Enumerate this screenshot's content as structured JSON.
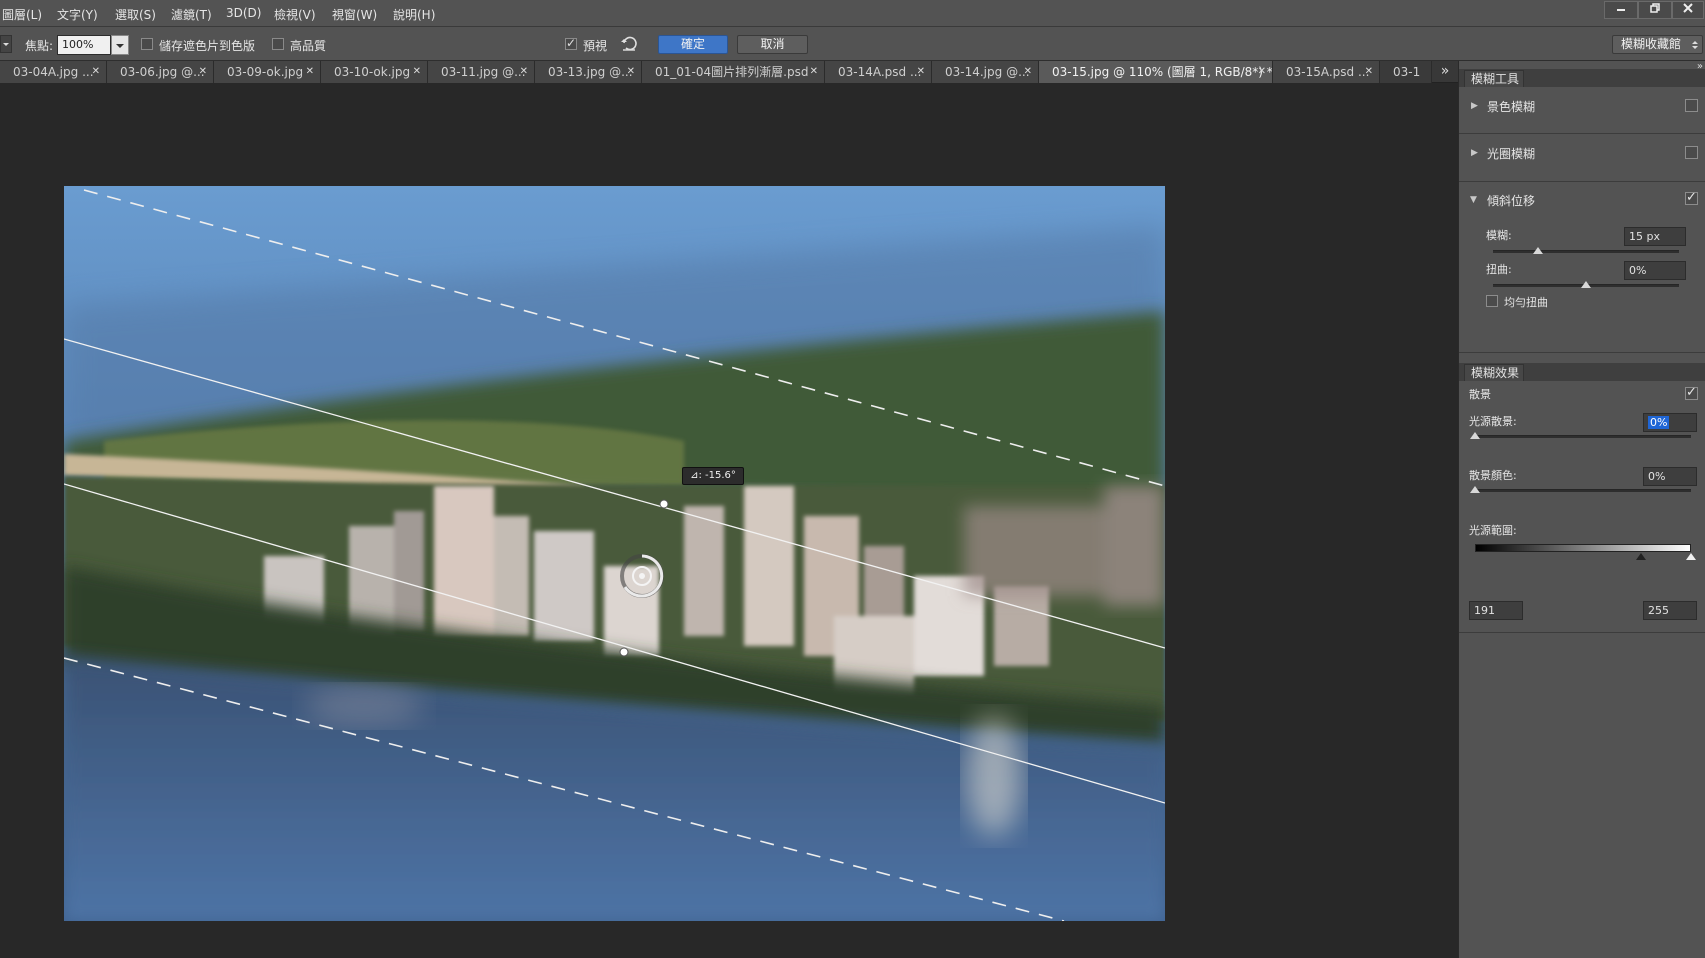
{
  "menubar": {
    "items": [
      "圖層(L)",
      "文字(Y)",
      "選取(S)",
      "濾鏡(T)",
      "3D(D)",
      "檢視(V)",
      "視窗(W)",
      "說明(H)"
    ]
  },
  "options": {
    "focus_label": "焦點:",
    "focus_value": "100%",
    "save_mask_label": "儲存遮色片到色版",
    "high_quality_label": "高品質",
    "preview_label": "預視",
    "ok_label": "確定",
    "cancel_label": "取消",
    "workspace_label": "模糊收藏館"
  },
  "tabs": [
    {
      "label": "03-04A.jpg ..."
    },
    {
      "label": "03-06.jpg @..."
    },
    {
      "label": "03-09-ok.jpg"
    },
    {
      "label": "03-10-ok.jpg"
    },
    {
      "label": "03-11.jpg @..."
    },
    {
      "label": "03-13.jpg @..."
    },
    {
      "label": "01_01-04圖片排列漸層.psd"
    },
    {
      "label": "03-14A.psd ..."
    },
    {
      "label": "03-14.jpg @..."
    },
    {
      "label": "03-15.jpg @ 110% (圖層 1, RGB/8*) *"
    },
    {
      "label": "03-15A.psd ..."
    },
    {
      "label": "03-1"
    }
  ],
  "tabs_overflow": "»",
  "canvas": {
    "angle_label": "⊿: -15.6°"
  },
  "blur_tools": {
    "tab_label": "模糊工具",
    "field_blur": {
      "label": "景色模糊",
      "checked": false
    },
    "iris_blur": {
      "label": "光圈模糊",
      "checked": false
    },
    "tilt_shift": {
      "label": "傾斜位移",
      "checked": true,
      "blur_label": "模糊:",
      "blur_value": "15 px",
      "blur_fraction": 0.24,
      "distortion_label": "扭曲:",
      "distortion_value": "0%",
      "distortion_fraction": 0.5,
      "symmetric_label": "均勻扭曲",
      "symmetric_checked": false
    }
  },
  "blur_effects": {
    "tab_label": "模糊效果",
    "bokeh_label": "散景",
    "bokeh_checked": true,
    "light_bokeh_label": "光源散景:",
    "light_bokeh_value": "0%",
    "bokeh_color_label": "散景顏色:",
    "bokeh_color_value": "0%",
    "light_range_label": "光源範圍:",
    "light_range_low": "191",
    "light_range_high": "255"
  }
}
